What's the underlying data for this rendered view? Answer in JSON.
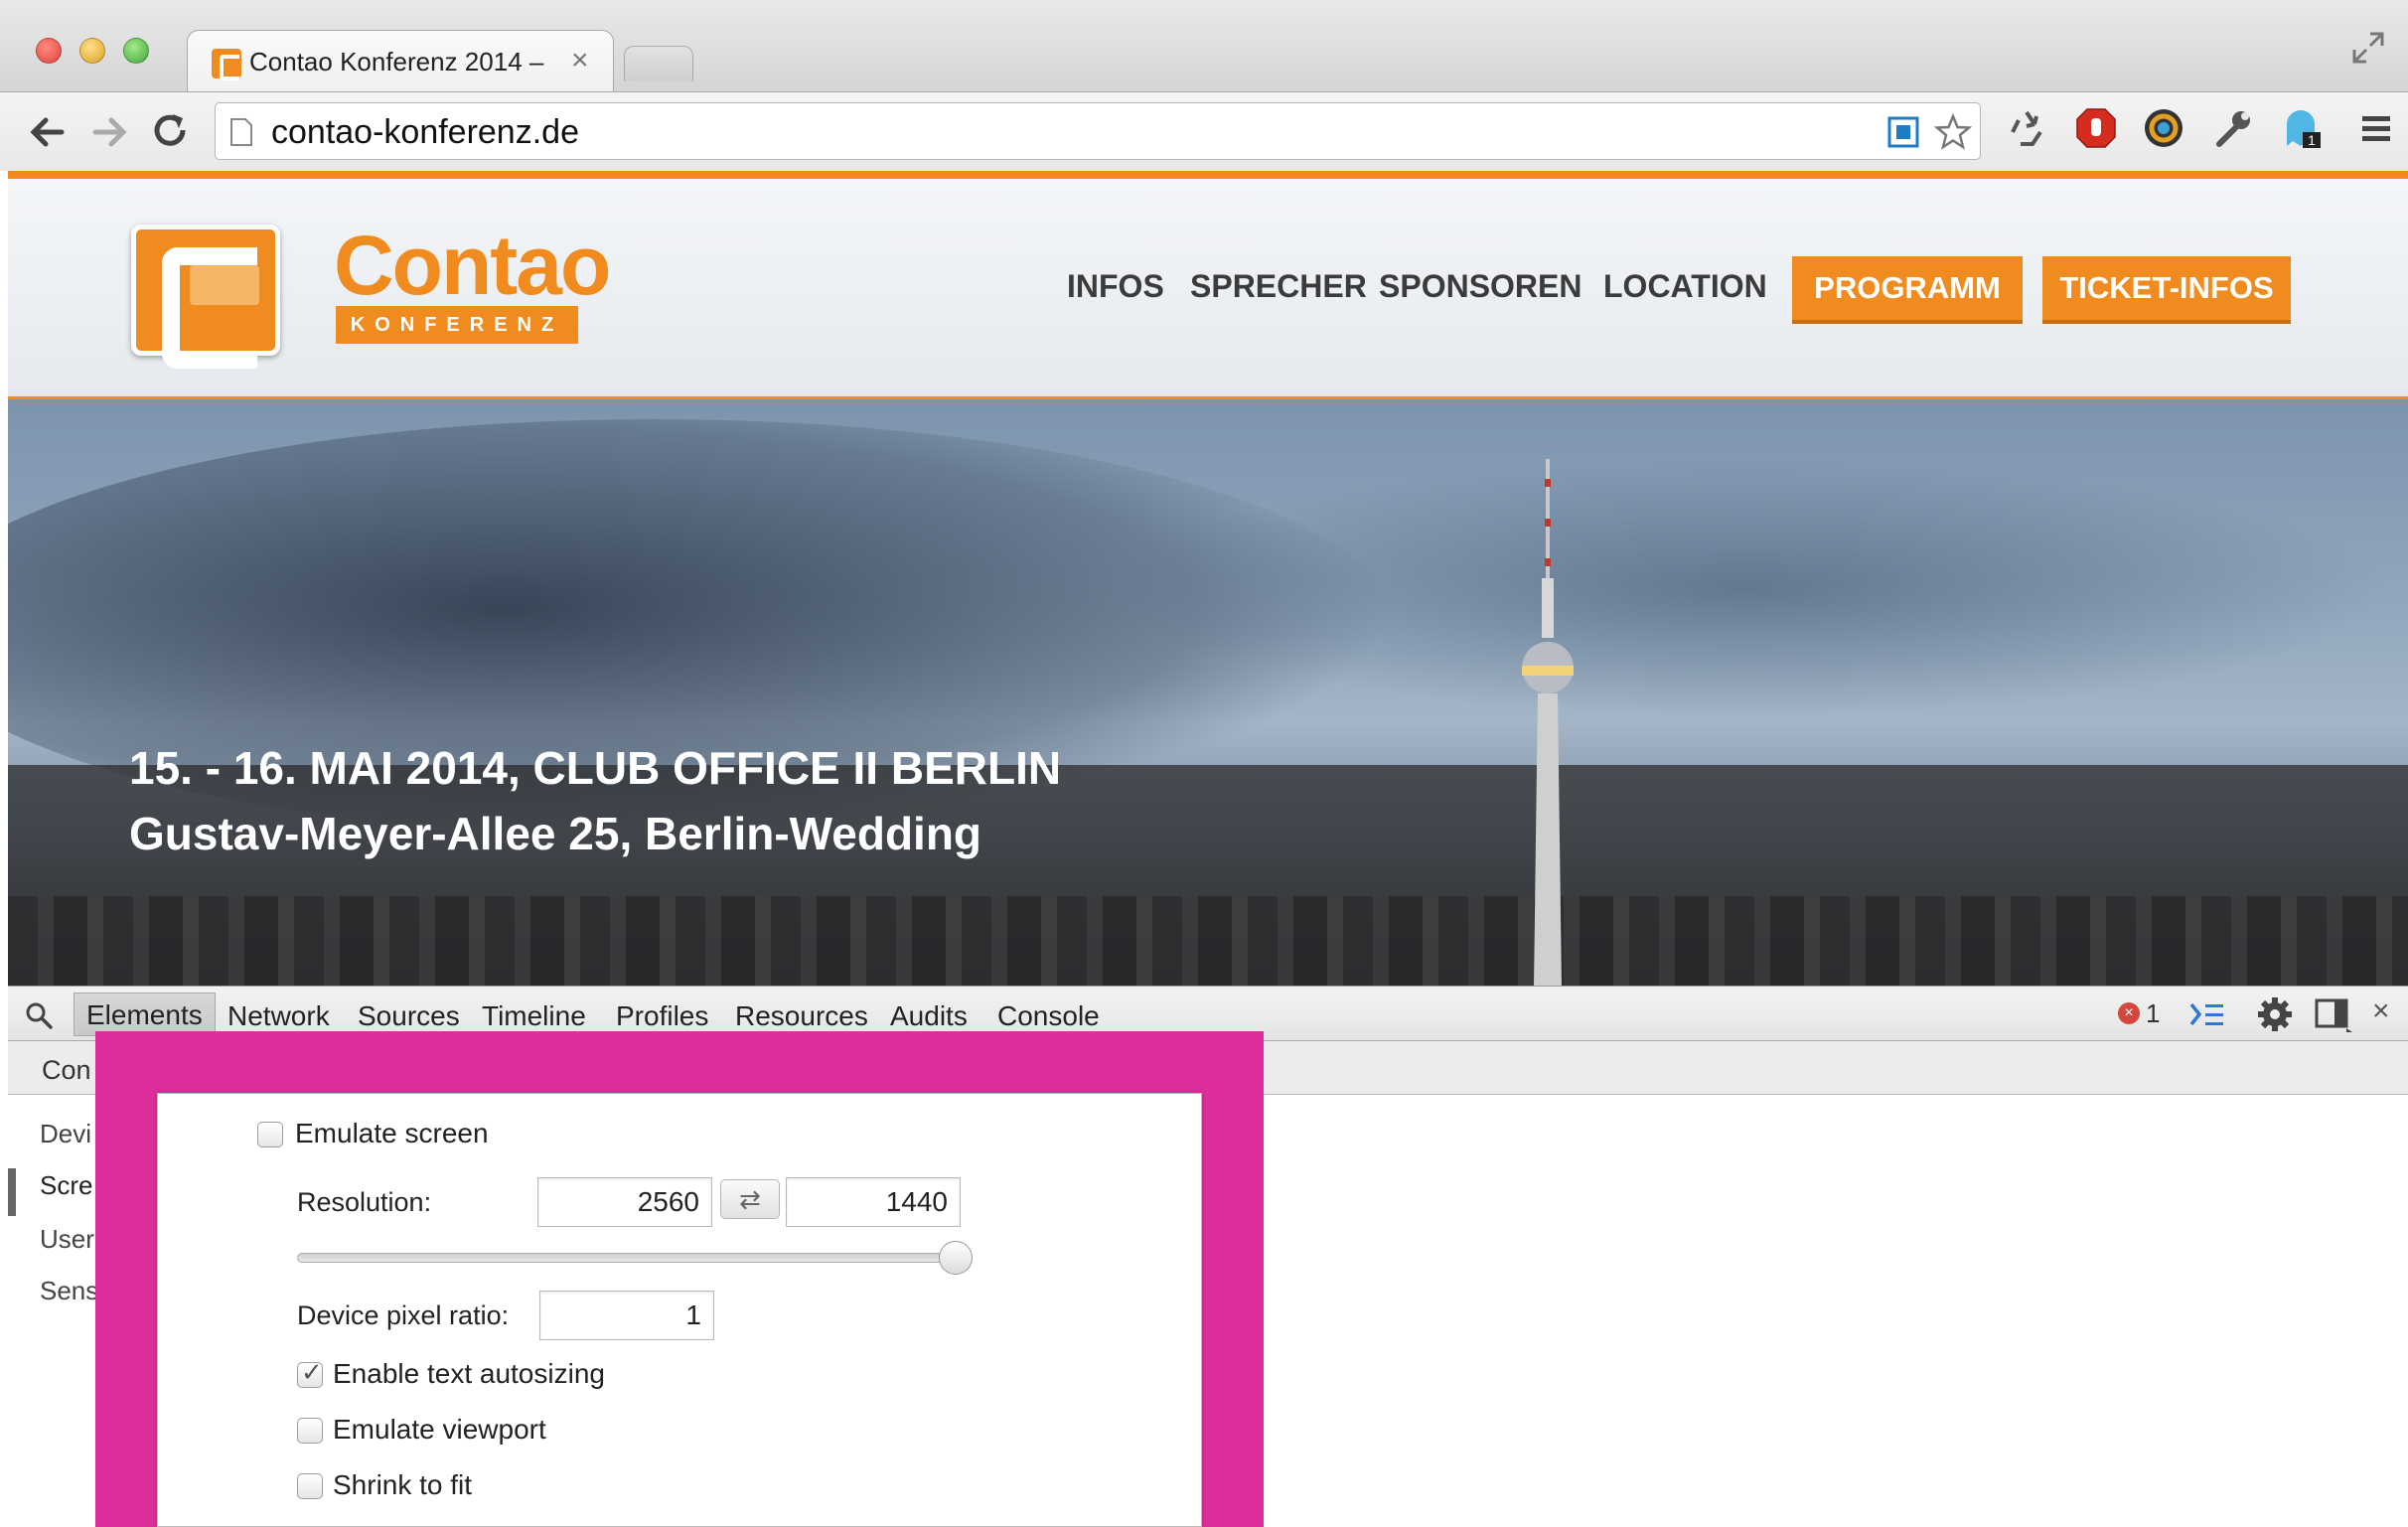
{
  "browser": {
    "tab_title": "Contao Konferenz 2014 –",
    "url": "contao-konferenz.de"
  },
  "site": {
    "logo_wordmark": "Contao",
    "logo_sub": "KONFERENZ",
    "nav": {
      "infos": "INFOS",
      "sprecher": "SPRECHER",
      "sponsoren": "SPONSOREN",
      "location": "LOCATION",
      "programm": "PROGRAMM",
      "tickets": "TICKET-INFOS"
    },
    "hero": {
      "line1": "15. - 16. MAI 2014, CLUB OFFICE II BERLIN",
      "line2": "Gustav-Meyer-Allee 25, Berlin-Wedding"
    },
    "colors": {
      "brand_orange": "#f08c1f",
      "highlight_magenta": "#de2e9c"
    }
  },
  "devtools": {
    "tabs": {
      "elements": "Elements",
      "network": "Network",
      "sources": "Sources",
      "timeline": "Timeline",
      "profiles": "Profiles",
      "resources": "Resources",
      "audits": "Audits",
      "console": "Console"
    },
    "error_count": "1",
    "drawer_tab": "Con",
    "sidebar": {
      "device": "Devi",
      "screen": "Scre",
      "user_agent": "User      nt",
      "sensors": "Sens"
    },
    "emulation": {
      "emulate_screen_label": "Emulate screen",
      "resolution_label": "Resolution:",
      "resolution_width": "2560",
      "resolution_height": "1440",
      "swap_symbol": "⇄",
      "device_pixel_ratio_label": "Device pixel ratio:",
      "device_pixel_ratio": "1",
      "enable_text_autosizing_label": "Enable text autosizing",
      "enable_text_autosizing_checked": true,
      "emulate_viewport_label": "Emulate viewport",
      "shrink_to_fit_label": "Shrink to fit"
    }
  }
}
